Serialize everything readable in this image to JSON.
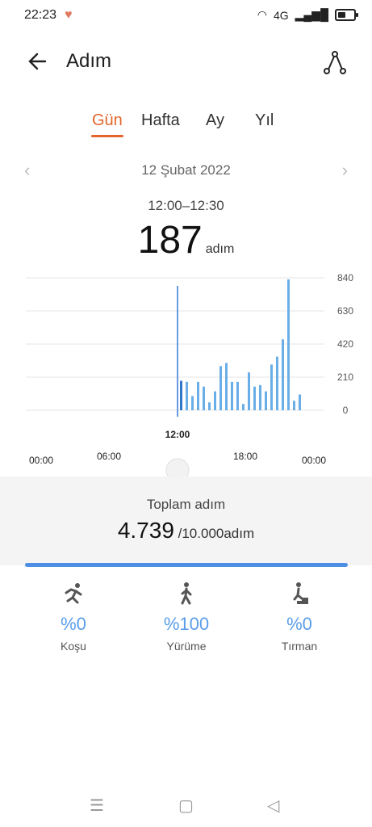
{
  "status": {
    "time": "22:23",
    "network": "4G",
    "signal": "▂▄▆█"
  },
  "app": {
    "title": "Adım"
  },
  "tabs": [
    "Gün",
    "Hafta",
    "Ay",
    "Yıl"
  ],
  "date_nav": {
    "date": "12 Şubat 2022"
  },
  "selected": {
    "range": "12:00–12:30",
    "value": "187",
    "unit": "adım"
  },
  "chart_data": {
    "type": "bar",
    "x_labels": [
      "00:00",
      "06:00",
      "12:00",
      "18:00",
      "00:00"
    ],
    "y_ticks": [
      0,
      210,
      420,
      630,
      840
    ],
    "selected_label": "12:00",
    "values": [
      187,
      180,
      90,
      180,
      150,
      50,
      120,
      280,
      300,
      180,
      180,
      40,
      240,
      150,
      160,
      120,
      290,
      340,
      450,
      830,
      60,
      100
    ],
    "ylim": [
      0,
      840
    ]
  },
  "summary": {
    "label": "Toplam adım",
    "total": "4.739",
    "goal": " /10.000adım",
    "progress": 1.0
  },
  "activities": [
    {
      "pct": "%0",
      "label": "Koşu"
    },
    {
      "pct": "%100",
      "label": "Yürüme"
    },
    {
      "pct": "%0",
      "label": "Tırman"
    }
  ]
}
